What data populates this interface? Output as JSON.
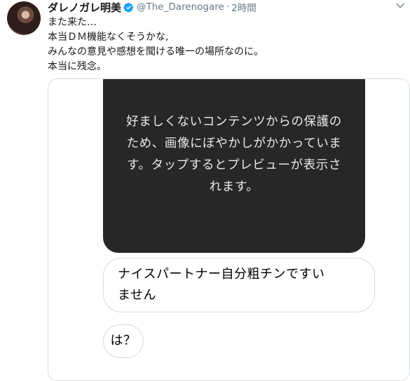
{
  "tweet": {
    "display_name": "ダレノガレ明美",
    "handle": "@The_Darenogare",
    "separator": "·",
    "timestamp": "2時間",
    "text_lines": [
      "また来た…",
      "本当ＤＭ機能なくそうかな,",
      "みんなの意見や感想を聞ける唯一の場所なのに。",
      "本当に残念。"
    ],
    "icons": {
      "verified": "verified-badge-icon",
      "more": "chevron-down-icon"
    },
    "colors": {
      "verified": "#1da1f2",
      "muted": "#657786"
    }
  },
  "media": {
    "blurred_notice_lines": [
      "好ましくないコンテンツからの保護の",
      "ため、画像にぼやかしがかかっていま",
      "す。タップするとプレビューが表示さ",
      "れます。"
    ],
    "message_bubbles": [
      {
        "lines": [
          "ナイスパートナー自分粗チンですい",
          "ません"
        ]
      },
      {
        "lines": [
          "は？"
        ]
      }
    ]
  }
}
